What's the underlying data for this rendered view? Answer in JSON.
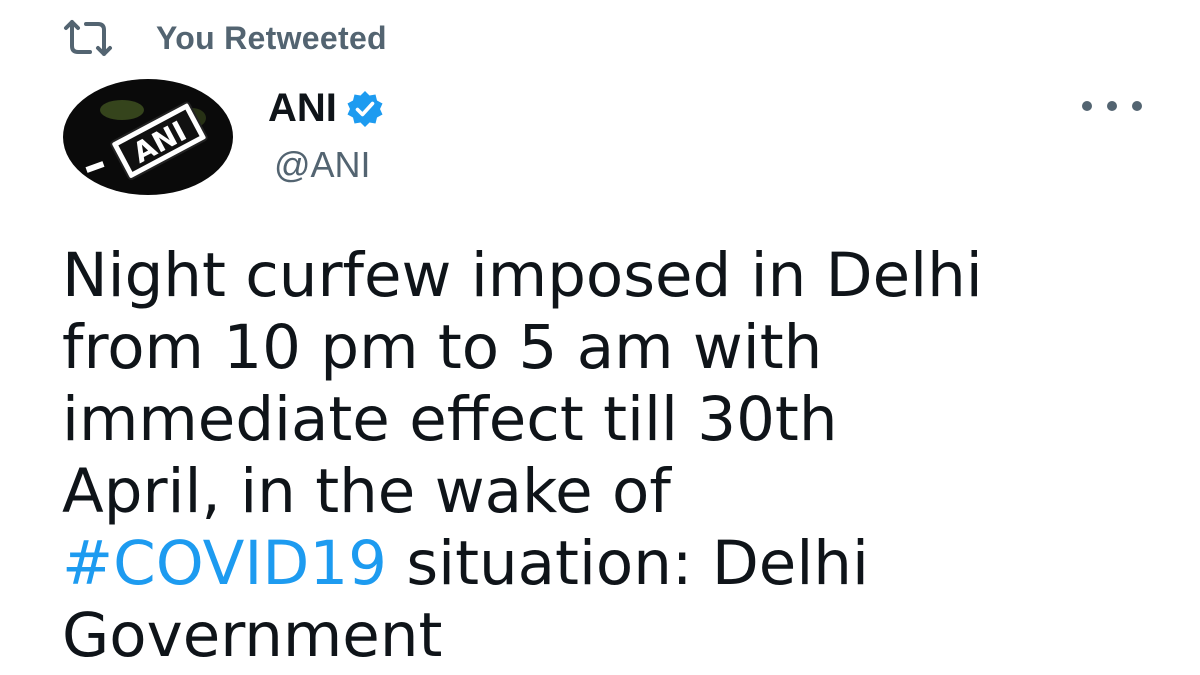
{
  "social_context": {
    "label": "You Retweeted",
    "icon": "retweet-icon"
  },
  "author": {
    "name": "ANI",
    "handle": "@ANI",
    "verified_icon": "verified-badge-icon",
    "avatar_text": "ANI"
  },
  "menu": {
    "icon": "more-options-icon"
  },
  "tweet": {
    "line1": "Night curfew imposed in Delhi",
    "line2": "from 10 pm to 5 am with",
    "line3": "immediate effect till 30th",
    "line4": "April, in the wake of",
    "hashtag": "#COVID19",
    "line5_rest": " situation: Delhi",
    "line6": "Government"
  },
  "colors": {
    "text": "#0f1419",
    "secondary": "#536471",
    "link": "#1d9bf0"
  }
}
